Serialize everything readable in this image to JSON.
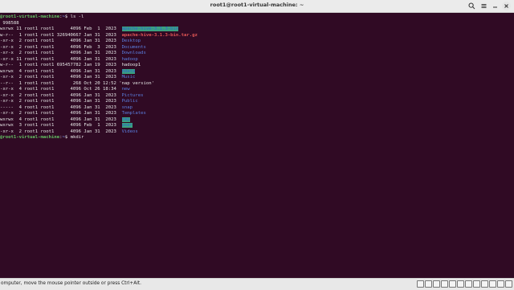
{
  "window": {
    "title": "root1@root1-virtual-machine: ~"
  },
  "terminal": {
    "lines": [
      {
        "segments": [
          {
            "text": "@root1-virtual-machine",
            "style": "prompt-user"
          },
          {
            "text": ":",
            "style": "plain"
          },
          {
            "text": "~",
            "style": "prompt-path"
          },
          {
            "text": "$ ls -l",
            "style": "plain"
          }
        ]
      },
      {
        "segments": [
          {
            "text": " 998588",
            "style": "plain"
          }
        ]
      },
      {
        "segments": [
          {
            "text": "wxrwx 11 root1 root1      4096 Feb  1  2023  ",
            "style": "plain"
          },
          {
            "text": "apache-hive-3.1.3-bin",
            "style": "hl"
          }
        ]
      },
      {
        "segments": [
          {
            "text": "w-r--  1 root1 root1 326940667 Jan 31  2023  ",
            "style": "plain"
          },
          {
            "text": "apache-hive-3.1.3-bin.tar.gz",
            "style": "red"
          }
        ]
      },
      {
        "segments": [
          {
            "text": "-xr-x  2 root1 root1      4096 Jan 31  2023  ",
            "style": "plain"
          },
          {
            "text": "Desktop",
            "style": "blue"
          }
        ]
      },
      {
        "segments": [
          {
            "text": "-xr-x  2 root1 root1      4096 Feb  3  2023  ",
            "style": "plain"
          },
          {
            "text": "Documents",
            "style": "blue"
          }
        ]
      },
      {
        "segments": [
          {
            "text": "-xr-x  2 root1 root1      4096 Jan 31  2023  ",
            "style": "plain"
          },
          {
            "text": "Downloads",
            "style": "blue"
          }
        ]
      },
      {
        "segments": [
          {
            "text": "-xr-x 11 root1 root1      4096 Jan 31  2023  ",
            "style": "plain"
          },
          {
            "text": "hadoop",
            "style": "blue"
          }
        ]
      },
      {
        "segments": [
          {
            "text": "w-r--  1 root1 root1 695457782 Jan 19  2023  ",
            "style": "plain"
          },
          {
            "text": "hadoop1",
            "style": "plain"
          }
        ]
      },
      {
        "segments": [
          {
            "text": "wxrwx  4 root1 root1      4096 Jan 31  2023  ",
            "style": "plain"
          },
          {
            "text": "hdata",
            "style": "hl"
          }
        ]
      },
      {
        "segments": [
          {
            "text": "-xr-x  2 root1 root1      4096 Jan 31  2023  ",
            "style": "plain"
          },
          {
            "text": "Music",
            "style": "blue"
          }
        ]
      },
      {
        "segments": [
          {
            "text": "--r--  1 root1 root1       268 Oct 20 12:52 ",
            "style": "plain"
          },
          {
            "text": "'nap version'",
            "style": "plain"
          }
        ]
      },
      {
        "segments": [
          {
            "text": "-xr-x  4 root1 root1      4096 Oct 26 18:34  ",
            "style": "plain"
          },
          {
            "text": "new",
            "style": "blue"
          }
        ]
      },
      {
        "segments": [
          {
            "text": "-xr-x  2 root1 root1      4096 Jan 31  2023  ",
            "style": "plain"
          },
          {
            "text": "Pictures",
            "style": "blue"
          }
        ]
      },
      {
        "segments": [
          {
            "text": "-xr-x  2 root1 root1      4096 Jan 31  2023  ",
            "style": "plain"
          },
          {
            "text": "Public",
            "style": "blue"
          }
        ]
      },
      {
        "segments": [
          {
            "text": "-----  4 root1 root1      4096 Jan 31  2023  ",
            "style": "plain"
          },
          {
            "text": "snap",
            "style": "blue"
          }
        ]
      },
      {
        "segments": [
          {
            "text": "-xr-x  2 root1 root1      4096 Jan 31  2023  ",
            "style": "plain"
          },
          {
            "text": "Templates",
            "style": "blue"
          }
        ]
      },
      {
        "segments": [
          {
            "text": "wxrwx  4 root1 root1      4096 Jan 31  2023  ",
            "style": "plain"
          },
          {
            "text": "tmp",
            "style": "hl"
          }
        ]
      },
      {
        "segments": [
          {
            "text": "wxrwx  3 root1 root1      4096 Feb  1  2023  ",
            "style": "plain"
          },
          {
            "text": "user",
            "style": "hl"
          }
        ]
      },
      {
        "segments": [
          {
            "text": "-xr-x  2 root1 root1      4096 Jan 31  2023  ",
            "style": "plain"
          },
          {
            "text": "Videos",
            "style": "blue"
          }
        ]
      },
      {
        "segments": [
          {
            "text": "@root1-virtual-machine",
            "style": "prompt-user"
          },
          {
            "text": ":",
            "style": "plain"
          },
          {
            "text": "~",
            "style": "prompt-path"
          },
          {
            "text": "$ mkdir",
            "style": "plain"
          }
        ]
      }
    ]
  },
  "statusbar": {
    "text": "omputer, move the mouse pointer outside or press Ctrl+Alt."
  },
  "colors": {
    "terminal_bg": "#300a24",
    "prompt_user": "#64c364",
    "directory": "#5b7fe0",
    "archive": "#e05555",
    "sticky_dir_bg": "#3aa07f"
  },
  "icons": {
    "titlebar": [
      "search-icon",
      "hamburger-menu-icon",
      "minimize-icon",
      "close-icon"
    ],
    "tray": [
      "hdd-icon",
      "optical-drive-icon",
      "audio-icon",
      "network-icon",
      "usb-icon",
      "shared-folder-icon",
      "display-icon",
      "capture-icon",
      "recording-icon",
      "cpu-icon",
      "mouse-integration-icon",
      "host-key-icon"
    ]
  }
}
